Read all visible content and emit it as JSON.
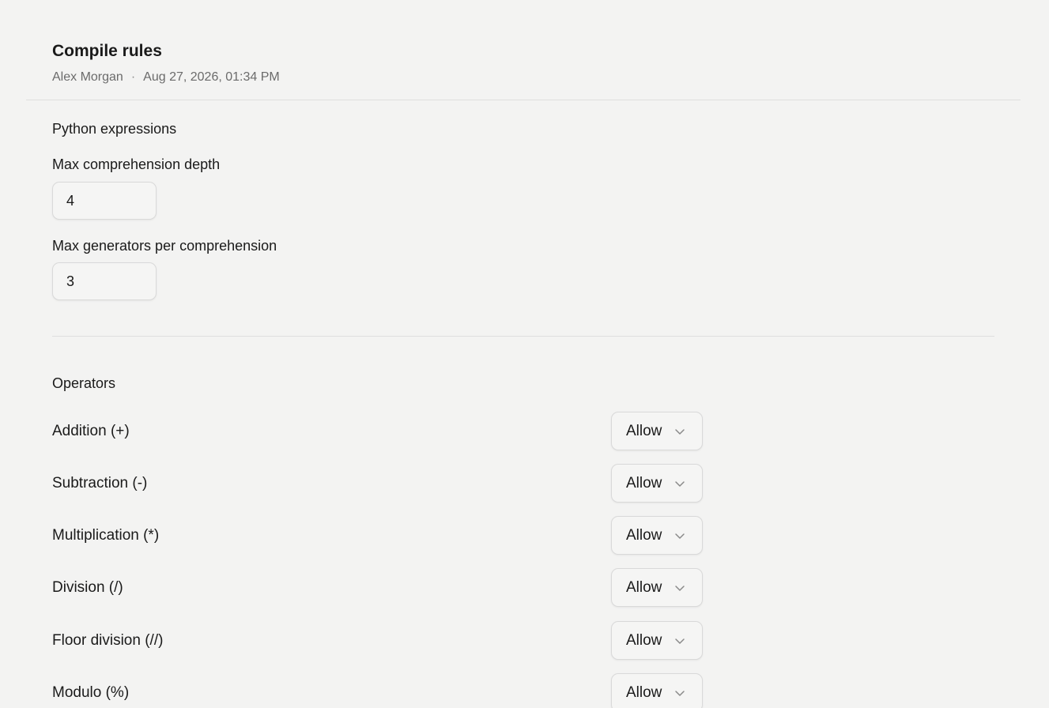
{
  "header": {
    "title": "Compile rules",
    "author": "Alex Morgan",
    "separator": "·",
    "timestamp": "Aug 27, 2026, 01:34 PM"
  },
  "python_expressions": {
    "section_title": "Python expressions",
    "fields": [
      {
        "label": "Max comprehension depth",
        "value": "4"
      },
      {
        "label": "Max generators per comprehension",
        "value": "3"
      }
    ]
  },
  "operators": {
    "section_title": "Operators",
    "dropdown_icon": "chevron-down-icon",
    "rows": [
      {
        "label": "Addition (+)",
        "value": "Allow"
      },
      {
        "label": "Subtraction (-)",
        "value": "Allow"
      },
      {
        "label": "Multiplication (*)",
        "value": "Allow"
      },
      {
        "label": "Division (/)",
        "value": "Allow"
      },
      {
        "label": "Floor division (//)",
        "value": "Allow"
      },
      {
        "label": "Modulo (%)",
        "value": "Allow"
      }
    ]
  }
}
